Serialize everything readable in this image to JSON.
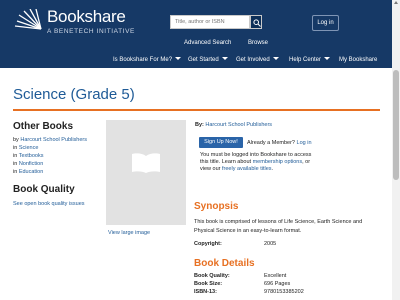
{
  "header": {
    "logo_text": "Bookshare",
    "logo_sub": "A BENETECH INITIATIVE",
    "search_placeholder": "Title, author or ISBN",
    "login_label": "Log in",
    "links": [
      "Advanced Search",
      "Browse"
    ],
    "nav": [
      "Is Bookshare For Me?",
      "Get Started",
      "Get Involved",
      "Help Center",
      "My Bookshare"
    ]
  },
  "page": {
    "title": "Science (Grade 5)"
  },
  "sidebar": {
    "other_books_heading": "Other Books",
    "links": [
      {
        "prefix": "by",
        "text": "Harcourt School Publishers"
      },
      {
        "prefix": "in",
        "text": "Science"
      },
      {
        "prefix": "in",
        "text": "Textbooks"
      },
      {
        "prefix": "in",
        "text": "Nonfiction"
      },
      {
        "prefix": "in",
        "text": "Education"
      }
    ],
    "quality_heading": "Book Quality",
    "quality_link": "See open book quality issues"
  },
  "book": {
    "view_large": "View large image",
    "by_label": "By:",
    "author": "Harcourt School Publishers",
    "signup_label": "Sign Up Now!",
    "already_member": "Already a Member?",
    "login_link": "Log in",
    "access_text_1": "You must be logged into Bookshare to access this title. Learn about",
    "membership_link": "membership options",
    "access_text_2": ", or view our",
    "free_titles_link": "freely available titles",
    "access_text_3": "."
  },
  "synopsis": {
    "heading": "Synopsis",
    "text": "This book is comprised of lessons of Life Science, Earth Science and Physical Science in an easy-to-learn format.",
    "copyright_label": "Copyright:",
    "copyright_value": "2005"
  },
  "details": {
    "heading": "Book Details",
    "rows": [
      {
        "k": "Book Quality:",
        "v": "Excellent"
      },
      {
        "k": "Book Size:",
        "v": "696 Pages"
      },
      {
        "k": "ISBN-13:",
        "v": "9780153385202"
      }
    ]
  },
  "colors": {
    "header_bg": "#163966",
    "accent": "#e77022",
    "link": "#1f5b97"
  }
}
